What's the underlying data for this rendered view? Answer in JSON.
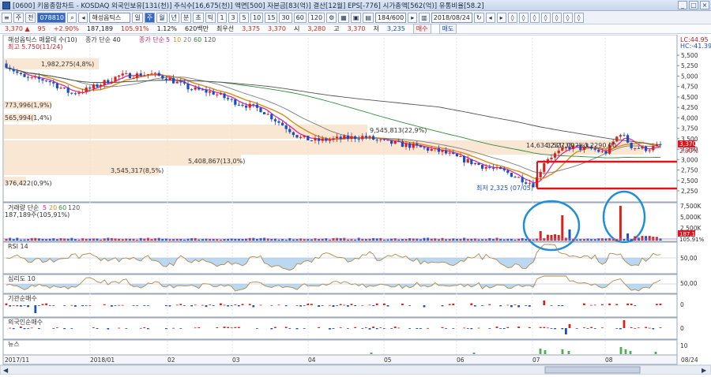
{
  "window": {
    "title": "[0600] 키움종합차트 - KOSDAQ 외국인보유[131(천)] 주식수[16,675(천)] 액면[500] 자본금[83(억)] 결산[12월] EPS[-776] 시가총액[562(억)] 유통비율[58.2]"
  },
  "toolbar": {
    "code": "078810",
    "stock_name": "해성옵틱스",
    "mode": "주",
    "jeon": "전",
    "period_labels": [
      "일",
      "주",
      "월",
      "년",
      "분",
      "초",
      "틱"
    ],
    "minute_labels": [
      "1",
      "3",
      "5",
      "10",
      "15",
      "30",
      "60",
      "120"
    ],
    "count": "184/600",
    "date": "2018/08/24"
  },
  "info": {
    "price": "3,370",
    "change": "95",
    "change_pct": "+2.90%",
    "volume": "187,189",
    "vol_pct": "105.91%",
    "turnover": "1.12%",
    "amount": "620백만",
    "shares_label": "최우선",
    "bid": "3,375",
    "ask": "3,370",
    "open_label": "시",
    "open": "3,280",
    "high_label": "고",
    "high": "3,370",
    "low_label": "저",
    "low": "3,235",
    "buy_btn": "매수",
    "sell_btn": "매도"
  },
  "price_panel": {
    "legend_name": "해성옵틱스 매물대 수(10)",
    "legend_close": "종가 단순 40",
    "legend_ma": "종가 단순",
    "ma_periods": [
      "5",
      "10",
      "20",
      "60",
      "120"
    ],
    "lc": "LC:44.95",
    "hc": "HC:-41.39",
    "high_note": "최고 5.750(11/24)",
    "low_note": "최저 2,325 (07/05)",
    "profile_labels": [
      "1,982,275(4,8%)",
      "773,996(1,9%)",
      "565,994(1,4%)",
      "9,545,813(22,9%)",
      "14,634,231(35,2%)",
      "5,408,867(13,0%)",
      "3,545,317(8,5%)",
      "376,422(0,9%)"
    ],
    "current_note": "3,527,00 → 3,2290,00",
    "axis_current": "3,370",
    "axis_pct": "2.90%",
    "y_ticks": [
      "5,500",
      "5,250",
      "5,000",
      "4,750",
      "4,500",
      "4,250",
      "4,000",
      "3,750",
      "3,500",
      "3,250",
      "3,000",
      "2,750",
      "2,500",
      "2,250"
    ]
  },
  "volume_panel": {
    "legend": "거래량 단순",
    "periods": [
      "5",
      "20",
      "60",
      "120"
    ],
    "value": "187,189주(105,91%)",
    "y_ticks": [
      "7,500K",
      "5,000K",
      "2,500K"
    ],
    "current": "187,189",
    "current_pct": "105.91%"
  },
  "rsi_panel": {
    "legend": "RSI 14",
    "y_tick": "50,00"
  },
  "psy_panel": {
    "legend": "심리도 10",
    "y_tick": "50,00"
  },
  "inst_panel": {
    "legend": "기관순매수",
    "y_tick": "0"
  },
  "foreign_panel": {
    "legend": "외국인순매수",
    "y_tick": "0"
  },
  "news_panel": {
    "legend": "뉴스",
    "y_tick": "10"
  },
  "x_axis": {
    "labels": [
      "2017/11",
      "2018/01",
      "02",
      "03",
      "04",
      "05",
      "06",
      "07",
      "08",
      "08/24"
    ]
  },
  "colors": {
    "up": "#d8231d",
    "down": "#1b4fbf",
    "ma5": "#e6199f",
    "ma10": "#d98b16",
    "ma20": "#7e7e7e",
    "ma60": "#2f8f3a",
    "ma120": "#555555",
    "profile": "#f7dfc4",
    "circle": "#1e8fd6",
    "support": "#e0141b"
  }
}
